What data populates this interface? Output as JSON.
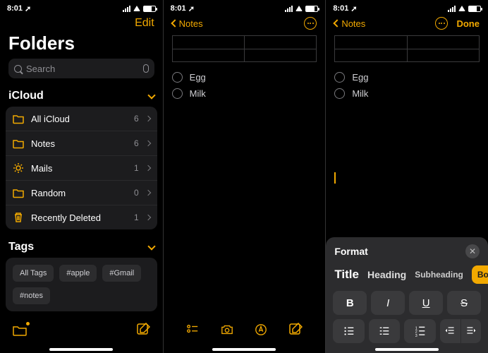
{
  "status": {
    "time": "8:01",
    "loc_glyph": "➚"
  },
  "screen1": {
    "edit": "Edit",
    "title": "Folders",
    "search_placeholder": "Search",
    "section_icloud": "iCloud",
    "folders": [
      {
        "icon": "folder",
        "label": "All iCloud",
        "count": "6"
      },
      {
        "icon": "folder",
        "label": "Notes",
        "count": "6"
      },
      {
        "icon": "gear",
        "label": "Mails",
        "count": "1"
      },
      {
        "icon": "folder",
        "label": "Random",
        "count": "0"
      },
      {
        "icon": "trash",
        "label": "Recently Deleted",
        "count": "1"
      }
    ],
    "section_tags": "Tags",
    "tags": [
      "All Tags",
      "#apple",
      "#Gmail",
      "#notes"
    ]
  },
  "screen2": {
    "back": "Notes",
    "items": [
      "Egg",
      "Milk"
    ]
  },
  "screen3": {
    "back": "Notes",
    "done": "Done",
    "items": [
      "Egg",
      "Milk"
    ],
    "format": {
      "title": "Format",
      "styles": {
        "title": "Title",
        "heading": "Heading",
        "sub": "Subheading",
        "body": "Body"
      },
      "bold": "B",
      "italic": "I",
      "underline": "U",
      "strike": "S"
    }
  }
}
